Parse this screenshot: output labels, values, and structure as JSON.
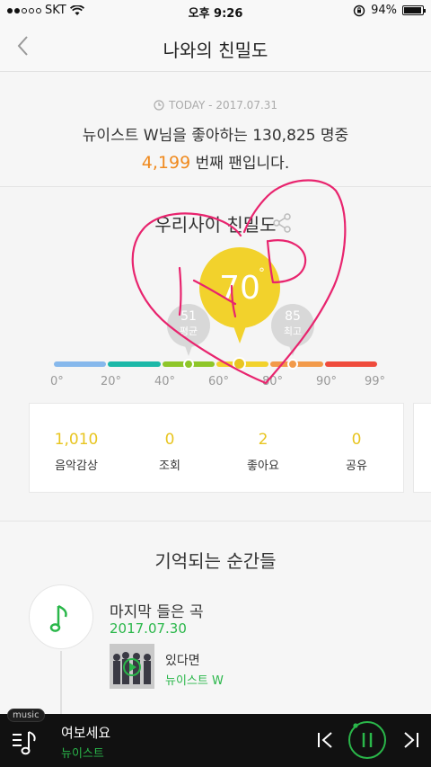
{
  "status_bar": {
    "carrier": "SKT",
    "time": "오후 9:26",
    "battery": "94%",
    "signal_dots_on": 2,
    "battery_level": 0.94
  },
  "nav": {
    "title": "나와의 친밀도",
    "back_icon": "chevron-left-icon"
  },
  "today": {
    "date": "TODAY - 2017.07.31",
    "fan_text": "뉴이스트 W님을 좋아하는 130,825 명중",
    "rank": "4,199",
    "rank_suffix": "번째 팬입니다."
  },
  "intimacy": {
    "title": "우리사이 친밀도",
    "value": "70",
    "degree": "°",
    "average_value": "51",
    "average_label": "평균",
    "max_value": "85",
    "max_label": "최고",
    "level": 70,
    "ticks": [
      "0°",
      "20°",
      "40°",
      "60°",
      "80°",
      "90°",
      "99°"
    ],
    "scale_colors": [
      "#86b8ec",
      "#1cb8a8",
      "#8ec629",
      "#f2d22c",
      "#f29a4a",
      "#ef4b3c"
    ],
    "stats": [
      {
        "value": "1,010",
        "label": "음악감상"
      },
      {
        "value": "0",
        "label": "조회"
      },
      {
        "value": "2",
        "label": "좋아요"
      },
      {
        "value": "0",
        "label": "공유"
      }
    ]
  },
  "memories": {
    "title": "기억되는 순간들",
    "item_title": "마지막 들은 곡",
    "item_date": "2017.07.30",
    "song_title": "있다면",
    "song_artist": "뉴이스트 W"
  },
  "player": {
    "tag": "music",
    "title": "여보세요",
    "artist": "뉴이스트"
  },
  "colors": {
    "accent_green": "#2ab74a",
    "accent_yellow": "#f2d22c",
    "rank_orange": "#f08a1e",
    "scribble": "#e8246e"
  }
}
